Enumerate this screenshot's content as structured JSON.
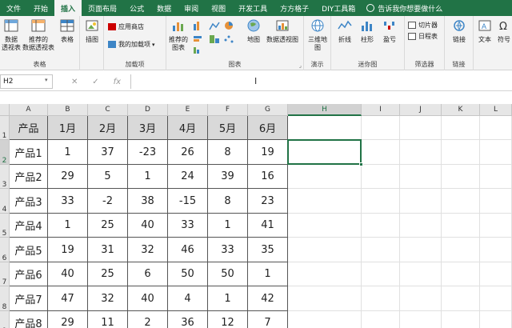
{
  "tabs": [
    "文件",
    "开始",
    "插入",
    "页面布局",
    "公式",
    "数据",
    "审阅",
    "视图",
    "开发工具",
    "方方格子",
    "DIY工具箱"
  ],
  "active_tab": 2,
  "tell_me": "告诉我你想要做什么",
  "ribbon": {
    "groups": {
      "tables": "表格",
      "addins": "加载项",
      "charts": "图表",
      "tours": "演示",
      "sparklines": "迷你图",
      "filters": "筛选器",
      "links": "链接"
    },
    "buttons": {
      "pivot_table": [
        "数据",
        "透视表"
      ],
      "recommended_pivot": [
        "推荐的",
        "数据透视表"
      ],
      "table": "表格",
      "illustrations": "插图",
      "app_store": "应用商店",
      "my_addins": "我的加载项",
      "recommended_charts": [
        "推荐的",
        "图表"
      ],
      "maps": "地图",
      "pivot_chart": "数据透视图",
      "map_3d": [
        "三维地",
        "图"
      ],
      "line": "折线",
      "column": "柱形",
      "win_loss": "盈亏",
      "slicer": "切片器",
      "timeline": "日程表",
      "link": "链接",
      "text": "文本",
      "symbol": "符号"
    }
  },
  "formula_bar": {
    "name_box": "H2",
    "cancel": "✕",
    "enter": "✓",
    "fx": "fx",
    "value": ""
  },
  "sheet": {
    "columns": [
      "A",
      "B",
      "C",
      "D",
      "E",
      "F",
      "G",
      "H",
      "I",
      "J",
      "K",
      "L"
    ],
    "selected_column": "H",
    "rows": [
      "1",
      "2",
      "3",
      "4",
      "5",
      "6",
      "7",
      "8",
      "9"
    ],
    "selected_row": "2",
    "header_row": [
      "产品",
      "1月",
      "2月",
      "3月",
      "4月",
      "5月",
      "6月"
    ],
    "data": [
      [
        "产品1",
        "1",
        "37",
        "-23",
        "26",
        "8",
        "19"
      ],
      [
        "产品2",
        "29",
        "5",
        "1",
        "24",
        "39",
        "16"
      ],
      [
        "产品3",
        "33",
        "-2",
        "38",
        "-15",
        "8",
        "23"
      ],
      [
        "产品4",
        "1",
        "25",
        "40",
        "33",
        "1",
        "41"
      ],
      [
        "产品5",
        "19",
        "31",
        "32",
        "46",
        "33",
        "35"
      ],
      [
        "产品6",
        "40",
        "25",
        "6",
        "50",
        "50",
        "1"
      ],
      [
        "产品7",
        "47",
        "32",
        "40",
        "4",
        "1",
        "42"
      ],
      [
        "产品8",
        "29",
        "11",
        "2",
        "36",
        "12",
        "7"
      ]
    ]
  }
}
